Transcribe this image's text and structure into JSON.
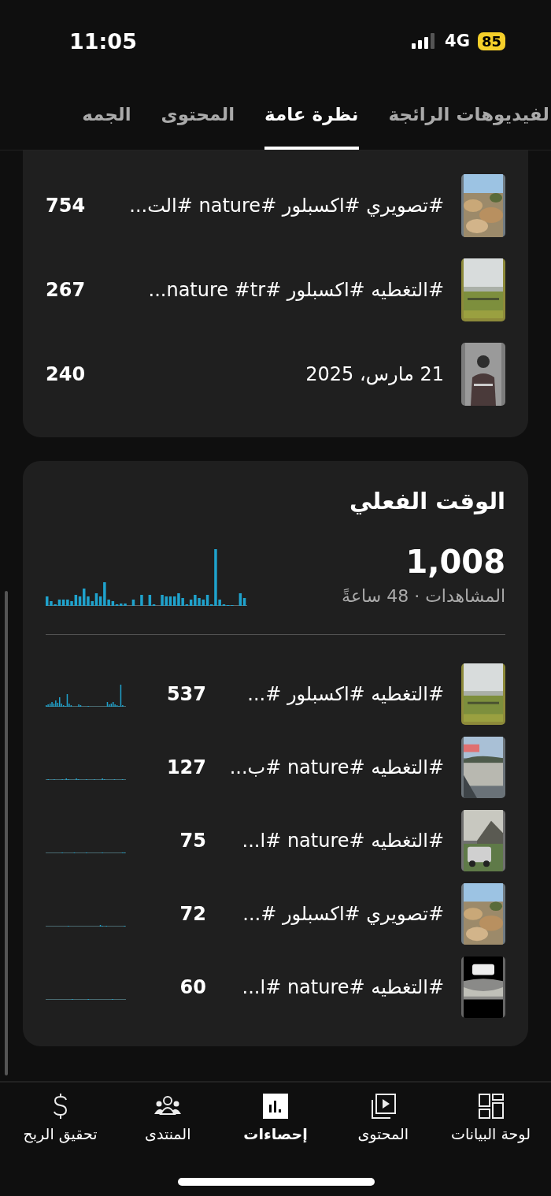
{
  "status_bar": {
    "time": "11:05",
    "network": "4G",
    "battery": "85"
  },
  "tabs": [
    {
      "label": "لفيديوهات الرائجة",
      "selected": false
    },
    {
      "label": "نظرة عامة",
      "selected": true
    },
    {
      "label": "المحتوى",
      "selected": false
    },
    {
      "label": "الجمه",
      "selected": false
    }
  ],
  "top_content": {
    "rows": [
      {
        "title": "#تصويري #اكسبلور #nature #الت...",
        "views": "754"
      },
      {
        "title": "#التغطيه #اكسبلور #nature #tr...",
        "views": "267"
      },
      {
        "title": "21 مارس، 2025",
        "views": "240"
      }
    ]
  },
  "realtime": {
    "title": "الوقت الفعلي",
    "total": "1,008",
    "subtitle": "المشاهدات · 48 ساعةً",
    "rows": [
      {
        "title": "#التغطيه #اكسبلور #...",
        "views": "537"
      },
      {
        "title": "#التغطيه #nature #ب...",
        "views": "127"
      },
      {
        "title": "#التغطيه #nature #ا...",
        "views": "75"
      },
      {
        "title": "#تصويري #اكسبلور #...",
        "views": "72"
      },
      {
        "title": "#التغطيه #nature #ا...",
        "views": "60"
      }
    ]
  },
  "bottom_nav": [
    {
      "label": "لوحة البيانات",
      "selected": false
    },
    {
      "label": "المحتوى",
      "selected": false
    },
    {
      "label": "إحصاءات",
      "selected": true
    },
    {
      "label": "المنتدى",
      "selected": false
    },
    {
      "label": "تحقيق الربح",
      "selected": false
    }
  ]
}
